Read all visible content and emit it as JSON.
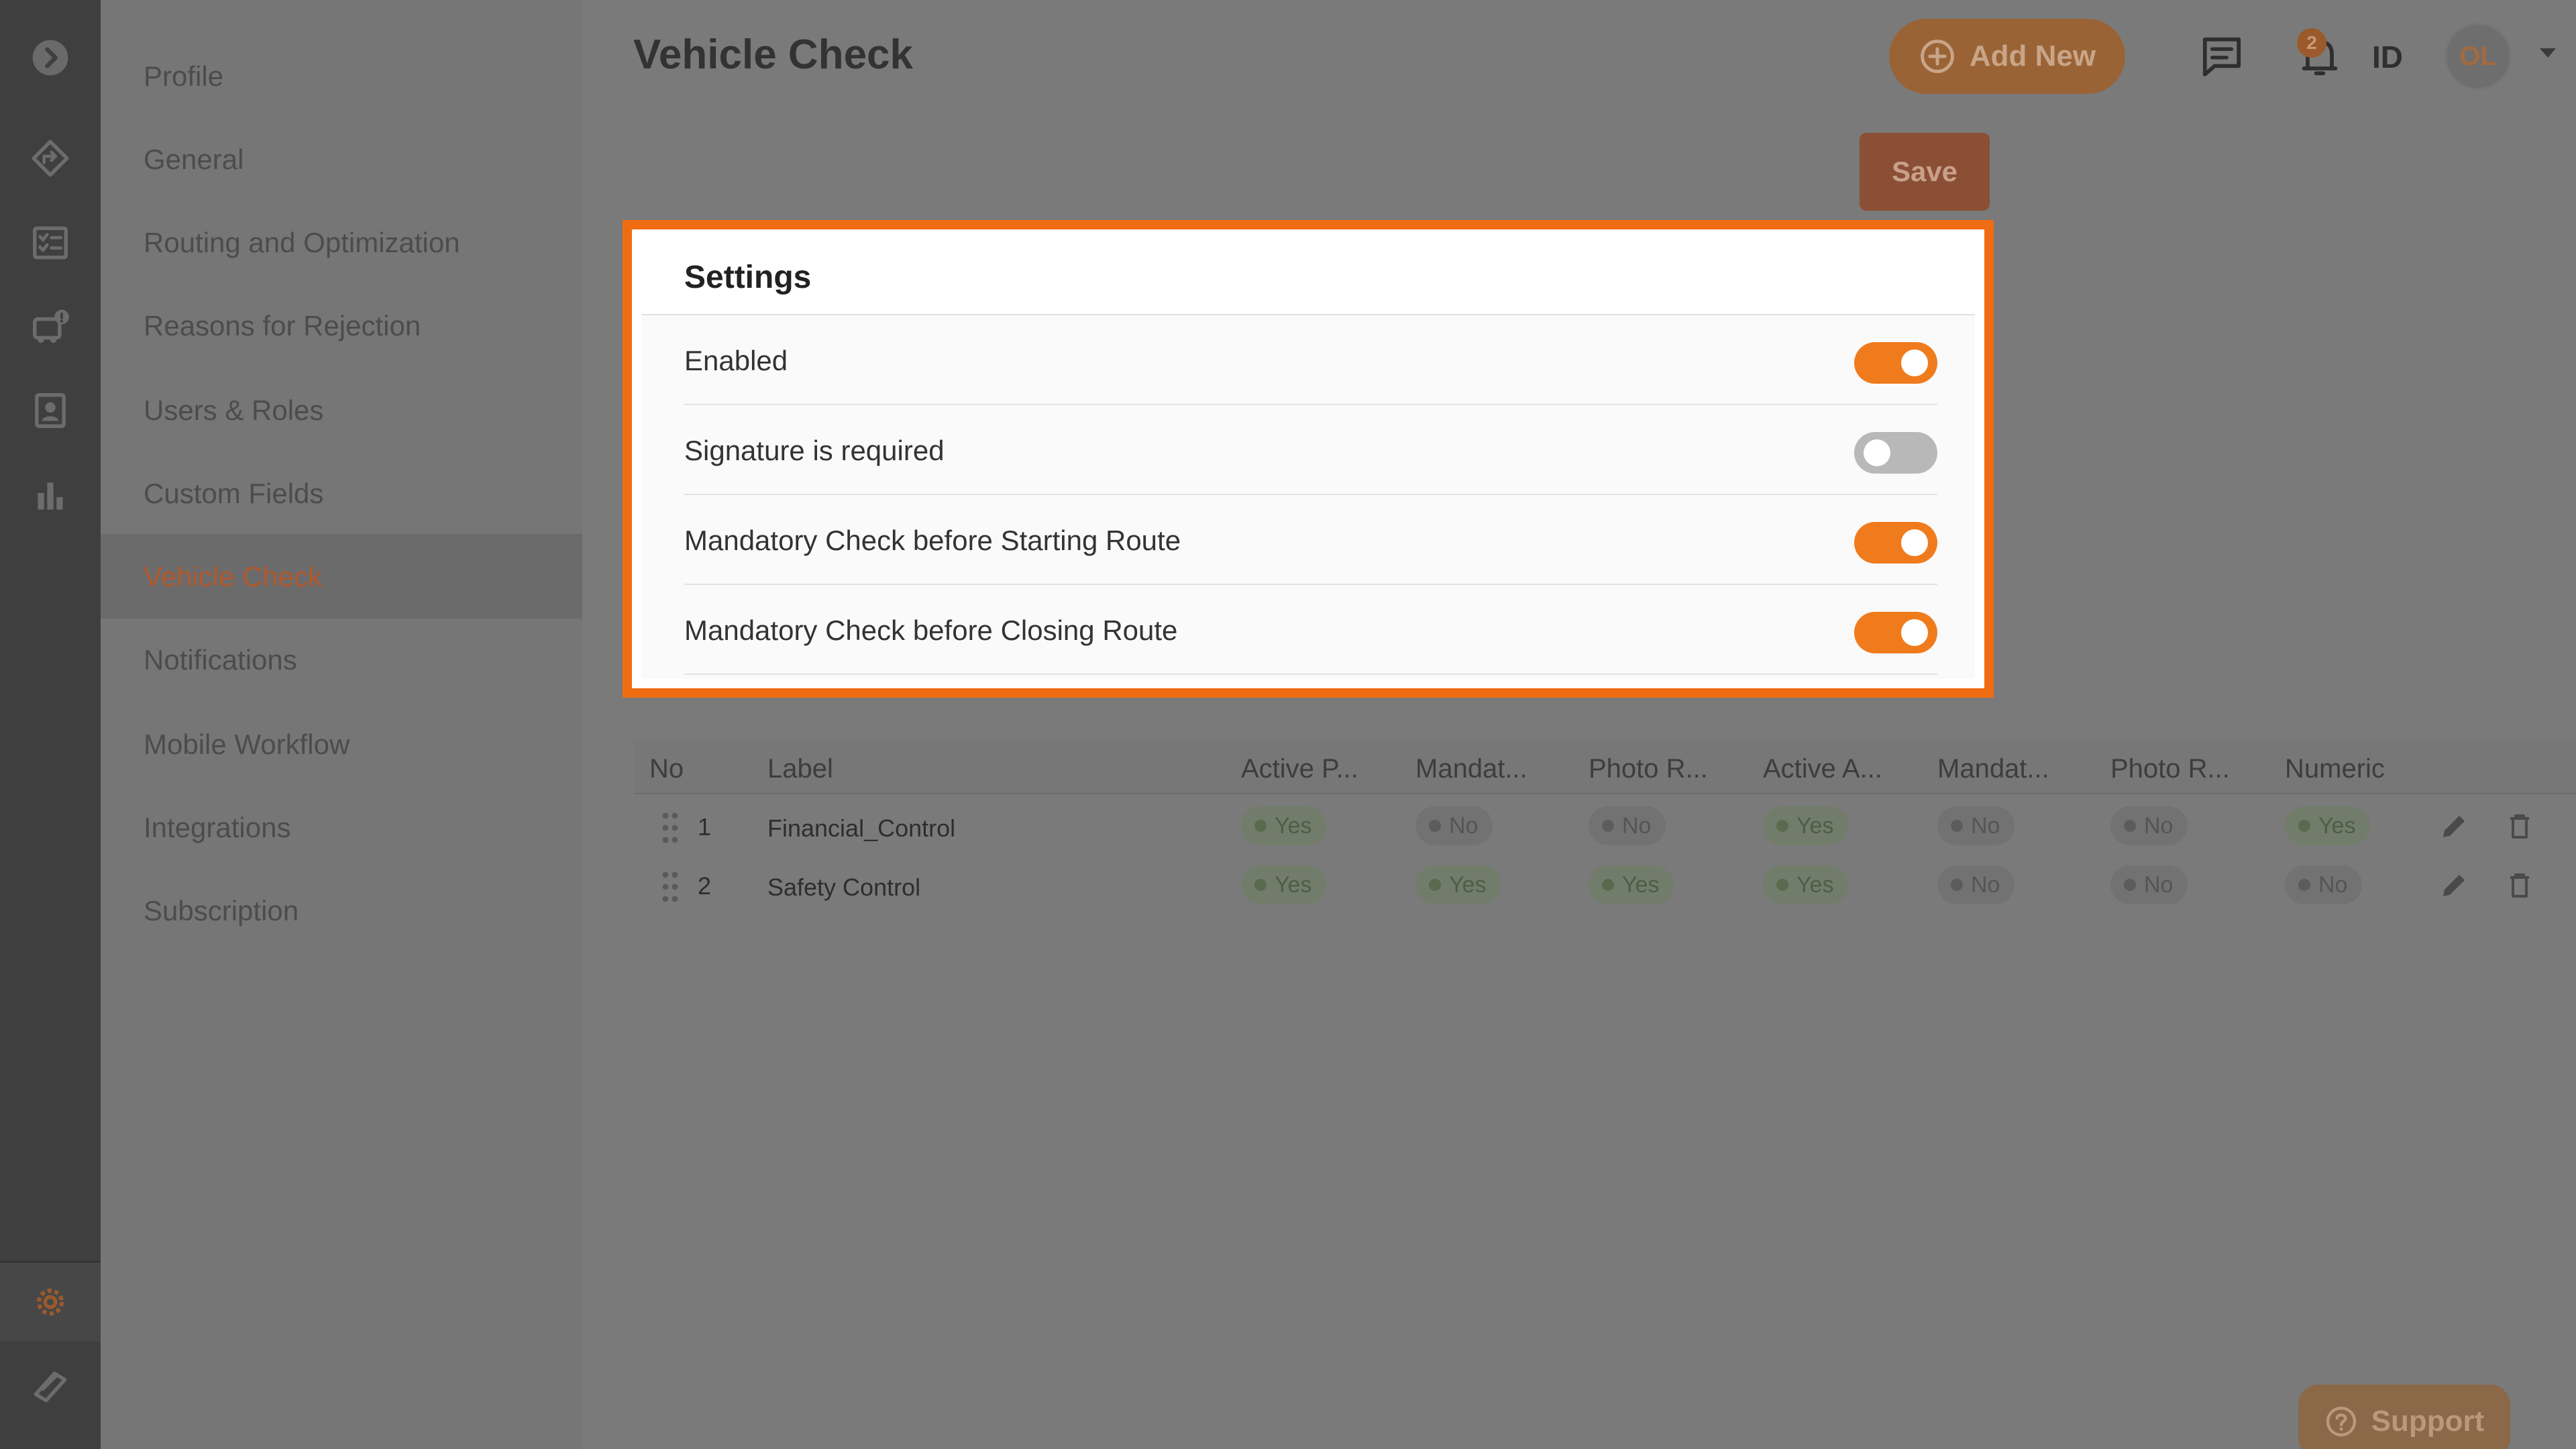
{
  "page": {
    "title": "Vehicle Check"
  },
  "header": {
    "add_new_label": "Add New",
    "notification_count": "2",
    "language": "ID",
    "avatar_initials": "OL"
  },
  "toolbar": {
    "save_label": "Save"
  },
  "rail": {
    "icons": [
      "expand-icon",
      "routing-icon",
      "checklist-icon",
      "vehicle-icon",
      "contacts-icon",
      "analytics-icon",
      "settings-icon",
      "learning-icon"
    ]
  },
  "sidebar": {
    "items": [
      {
        "label": "Profile"
      },
      {
        "label": "General"
      },
      {
        "label": "Routing and Optimization"
      },
      {
        "label": "Reasons for Rejection"
      },
      {
        "label": "Users & Roles"
      },
      {
        "label": "Custom Fields"
      },
      {
        "label": "Vehicle Check"
      },
      {
        "label": "Notifications"
      },
      {
        "label": "Mobile Workflow"
      },
      {
        "label": "Integrations"
      },
      {
        "label": "Subscription"
      }
    ],
    "active": "Vehicle Check"
  },
  "settings": {
    "title": "Settings",
    "rows": [
      {
        "label": "Enabled",
        "enabled": true
      },
      {
        "label": "Signature is required",
        "enabled": false
      },
      {
        "label": "Mandatory Check before Starting Route",
        "enabled": true
      },
      {
        "label": "Mandatory Check before Closing Route",
        "enabled": true
      }
    ]
  },
  "table": {
    "columns": [
      "No",
      "Label",
      "Active P...",
      "Mandat...",
      "Photo R...",
      "Active A...",
      "Mandat...",
      "Photo R...",
      "Numeric"
    ],
    "rows": [
      {
        "no": "1",
        "label": "Financial_Control",
        "values": [
          "Yes",
          "No",
          "No",
          "Yes",
          "No",
          "No",
          "Yes"
        ]
      },
      {
        "no": "2",
        "label": "Safety Control",
        "values": [
          "Yes",
          "Yes",
          "Yes",
          "Yes",
          "No",
          "No",
          "No"
        ]
      }
    ]
  },
  "support": {
    "label": "Support"
  },
  "colors": {
    "accent": "#f07b1d",
    "highlight": "#f06c12"
  }
}
